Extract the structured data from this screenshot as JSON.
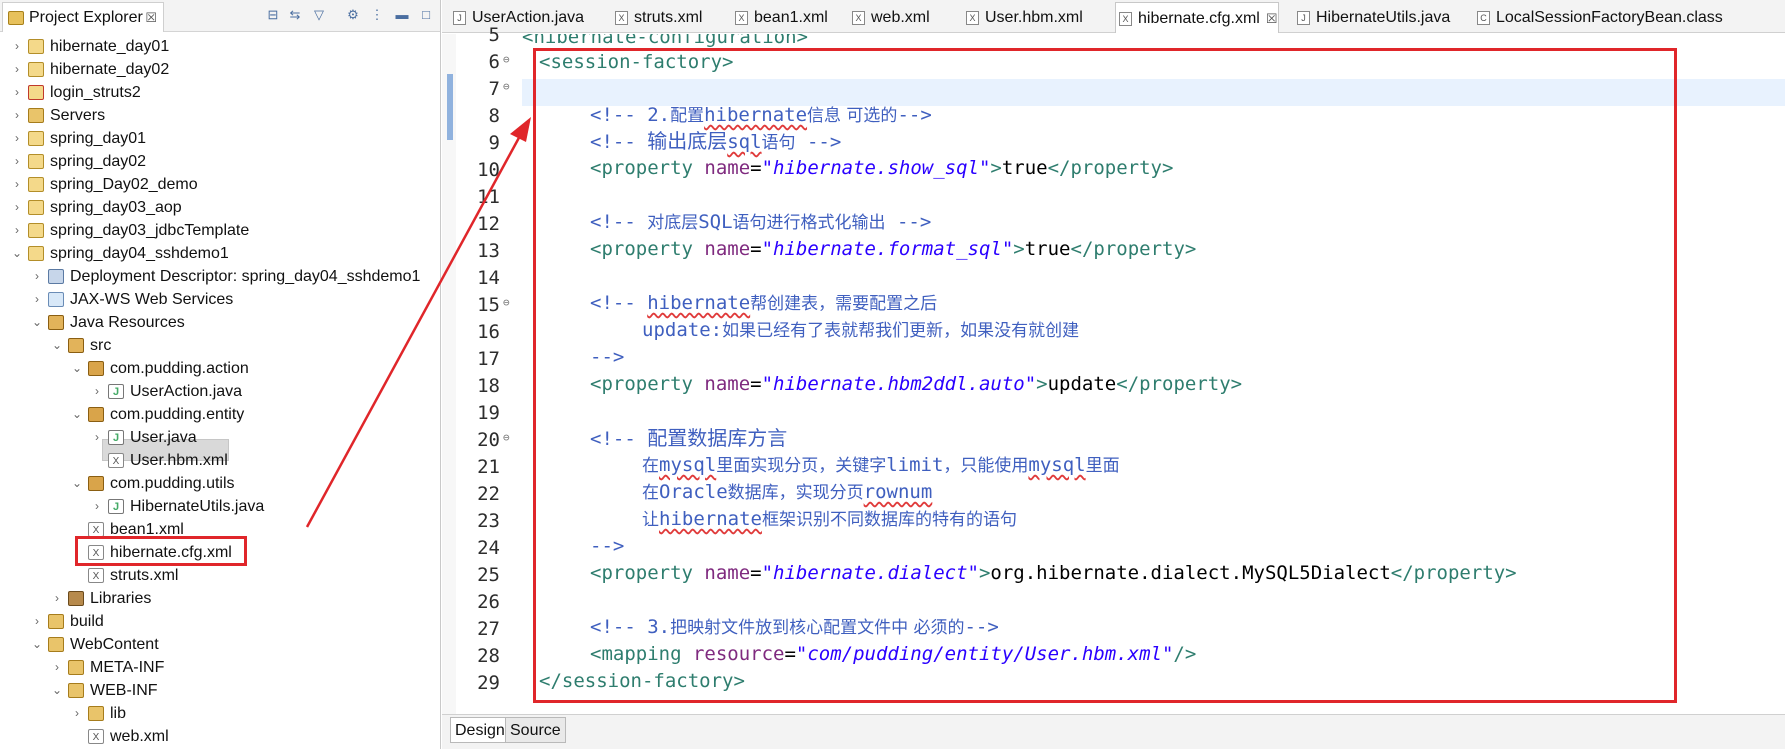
{
  "explorer": {
    "title": "Project Explorer",
    "close_glyph": "☒",
    "tools": [
      "collapse-all-icon",
      "link-editor-icon",
      "filter-icon",
      "sync-icon",
      "view-menu-icon",
      "minimize-icon",
      "maximize-icon"
    ],
    "items": [
      {
        "label": "hibernate_day01",
        "icon": "project-icon",
        "expanded": false
      },
      {
        "label": "hibernate_day02",
        "icon": "project-icon",
        "expanded": false
      },
      {
        "label": "login_struts2",
        "icon": "project-error-icon",
        "expanded": false
      },
      {
        "label": "Servers",
        "icon": "folder-icon",
        "expanded": false
      },
      {
        "label": "spring_day01",
        "icon": "project-icon",
        "expanded": false
      },
      {
        "label": "spring_day02",
        "icon": "project-icon",
        "expanded": false
      },
      {
        "label": "spring_Day02_demo",
        "icon": "project-icon",
        "expanded": false
      },
      {
        "label": "spring_day03_aop",
        "icon": "project-icon",
        "expanded": false
      },
      {
        "label": "spring_day03_jdbcTemplate",
        "icon": "project-icon",
        "expanded": false
      },
      {
        "label": "spring_day04_sshdemo1",
        "icon": "project-icon",
        "expanded": true
      },
      {
        "label": "Deployment Descriptor: spring_day04_sshdemo1",
        "icon": "descriptor-icon",
        "expanded": false
      },
      {
        "label": "JAX-WS Web Services",
        "icon": "web-services-icon",
        "expanded": false
      },
      {
        "label": "Java Resources",
        "icon": "java-resources-icon",
        "expanded": true
      },
      {
        "label": "src",
        "icon": "source-folder-icon",
        "expanded": true
      },
      {
        "label": "com.pudding.action",
        "icon": "package-icon",
        "expanded": true
      },
      {
        "label": "UserAction.java",
        "icon": "java-file-icon",
        "expanded": false
      },
      {
        "label": "com.pudding.entity",
        "icon": "package-icon",
        "expanded": true
      },
      {
        "label": "User.java",
        "icon": "java-file-icon",
        "expanded": false
      },
      {
        "label": "User.hbm.xml",
        "icon": "xml-file-icon",
        "expanded": false
      },
      {
        "label": "com.pudding.utils",
        "icon": "package-icon",
        "expanded": true
      },
      {
        "label": "HibernateUtils.java",
        "icon": "java-file-icon",
        "expanded": false
      },
      {
        "label": "bean1.xml",
        "icon": "xml-file-icon",
        "expanded": false
      },
      {
        "label": "hibernate.cfg.xml",
        "icon": "xml-file-icon",
        "expanded": false
      },
      {
        "label": "struts.xml",
        "icon": "xml-file-icon",
        "expanded": false
      },
      {
        "label": "Libraries",
        "icon": "libraries-icon",
        "expanded": false
      },
      {
        "label": "build",
        "icon": "folder-icon",
        "expanded": false
      },
      {
        "label": "WebContent",
        "icon": "folder-icon",
        "expanded": true
      },
      {
        "label": "META-INF",
        "icon": "folder-icon",
        "expanded": false
      },
      {
        "label": "WEB-INF",
        "icon": "folder-icon",
        "expanded": true
      },
      {
        "label": "lib",
        "icon": "folder-icon",
        "expanded": false
      },
      {
        "label": "web.xml",
        "icon": "xml-file-icon",
        "expanded": false
      }
    ]
  },
  "editor": {
    "tabs": [
      {
        "label": "UserAction.java",
        "icon": "java-file-icon"
      },
      {
        "label": "struts.xml",
        "icon": "xml-file-icon"
      },
      {
        "label": "bean1.xml",
        "icon": "xml-file-icon"
      },
      {
        "label": "web.xml",
        "icon": "xml-file-icon"
      },
      {
        "label": "User.hbm.xml",
        "icon": "xml-file-icon"
      },
      {
        "label": "hibernate.cfg.xml",
        "icon": "xml-file-icon",
        "active": true,
        "close": "☒"
      },
      {
        "label": "HibernateUtils.java",
        "icon": "java-file-icon"
      },
      {
        "label": "LocalSessionFactoryBean.class",
        "icon": "class-file-icon"
      }
    ],
    "line_numbers": [
      "5",
      "6",
      "7",
      "8",
      "9",
      "10",
      "11",
      "12",
      "13",
      "14",
      "15",
      "16",
      "17",
      "18",
      "19",
      "20",
      "21",
      "22",
      "23",
      "24",
      "25",
      "26",
      "27",
      "28",
      "29"
    ],
    "code": {
      "l5": "<hibernate-configuration>",
      "l6": "<session-factory>",
      "l8_open": "<!-- 2.",
      "l8_cn1": "配置",
      "l8_word": "hibernate",
      "l8_cn2": "信息 可选的",
      "l8_close": "-->",
      "l9_open": "<!-- ",
      "l9_cn1": "输出底层",
      "l9_word": "sql",
      "l9_cn2": "语句",
      "l9_close": " -->",
      "l10_tag1": "<property ",
      "l10_attr": "name",
      "l10_eq": "=",
      "l10_val": "\"hibernate.show_sql\"",
      "l10_gt": ">",
      "l10_txt": "true",
      "l10_tag2": "</property>",
      "l12_open": "<!-- ",
      "l12_cn1": "对底层",
      "l12_word": "SQL",
      "l12_cn2": "语句进行格式化输出",
      "l12_close": " -->",
      "l13_val": "\"hibernate.format_sql\"",
      "l13_txt": "true",
      "l15_open": "<!-- ",
      "l15_word": "hibernate",
      "l15_cn": "帮创建表，需要配置之后",
      "l16_word": "update:",
      "l16_cn": "如果已经有了表就帮我们更新，如果没有就创建",
      "l17": "-->",
      "l18_val": "\"hibernate.hbm2ddl.auto\"",
      "l18_txt": "update",
      "l20_open": "<!-- ",
      "l20_cn": "配置数据库方言",
      "l21_cn1": "在",
      "l21_w1": "mysql",
      "l21_cn2": "里面实现分页，关键字",
      "l21_w2": "limit",
      "l21_cn3": "，只能使用",
      "l21_w3": "mysql",
      "l21_cn4": "里面",
      "l22_cn1": "在",
      "l22_w1": "Oracle",
      "l22_cn2": "数据库，实现分页",
      "l22_w2": "rownum",
      "l23_cn1": "让",
      "l23_w1": "hibernate",
      "l23_cn2": "框架识别不同数据库的特有的语句",
      "l24": "-->",
      "l25_val": "\"hibernate.dialect\"",
      "l25_txt": "org.hibernate.dialect.MySQL5Dialect",
      "l27_open": "<!-- 3.",
      "l27_cn": "把映射文件放到核心配置文件中 必须的",
      "l27_close": "-->",
      "l28_tag1": "<mapping ",
      "l28_attr": "resource",
      "l28_val": "\"com/pudding/entity/User.hbm.xml\"",
      "l28_end": "/>",
      "l29": "</session-factory>"
    },
    "bottom_tabs": [
      "Design",
      "Source"
    ]
  },
  "annotation_color": "#e0262a"
}
